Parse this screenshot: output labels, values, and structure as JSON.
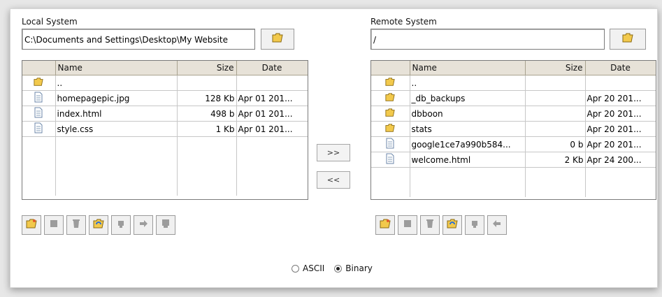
{
  "local": {
    "label": "Local System",
    "path": "C:\\Documents and Settings\\Desktop\\My Website",
    "columns": {
      "name": "Name",
      "size": "Size",
      "date": "Date"
    },
    "files": [
      {
        "icon": "folder-icon",
        "name": "..",
        "size": "",
        "date": ""
      },
      {
        "icon": "file-icon",
        "name": "homepagepic.jpg",
        "size": "128 Kb",
        "date": "Apr 01 201..."
      },
      {
        "icon": "file-icon",
        "name": "index.html",
        "size": "498 b",
        "date": "Apr 01 201..."
      },
      {
        "icon": "file-icon",
        "name": "style.css",
        "size": "1 Kb",
        "date": "Apr 01 201..."
      }
    ]
  },
  "remote": {
    "label": "Remote System",
    "path": "/",
    "columns": {
      "name": "Name",
      "size": "Size",
      "date": "Date"
    },
    "files": [
      {
        "icon": "folder-icon",
        "name": "..",
        "size": "",
        "date": ""
      },
      {
        "icon": "folder-icon",
        "name": "_db_backups",
        "size": "",
        "date": "Apr 20 201..."
      },
      {
        "icon": "folder-icon",
        "name": "dbboon",
        "size": "",
        "date": "Apr 20 201..."
      },
      {
        "icon": "folder-icon",
        "name": "stats",
        "size": "",
        "date": "Apr 20 201..."
      },
      {
        "icon": "file-icon",
        "name": "google1ce7a990b584...",
        "size": "0 b",
        "date": "Apr 20 201..."
      },
      {
        "icon": "file-icon",
        "name": "welcome.html",
        "size": "2 Kb",
        "date": "Apr 24 200..."
      }
    ]
  },
  "transfer": {
    "upload_label": ">>",
    "download_label": "<<"
  },
  "mode": {
    "ascii_label": "ASCII",
    "binary_label": "Binary",
    "selected": "Binary"
  },
  "colors": {
    "folder": "#f2c94c",
    "header_bg": "#e7e2d8"
  }
}
